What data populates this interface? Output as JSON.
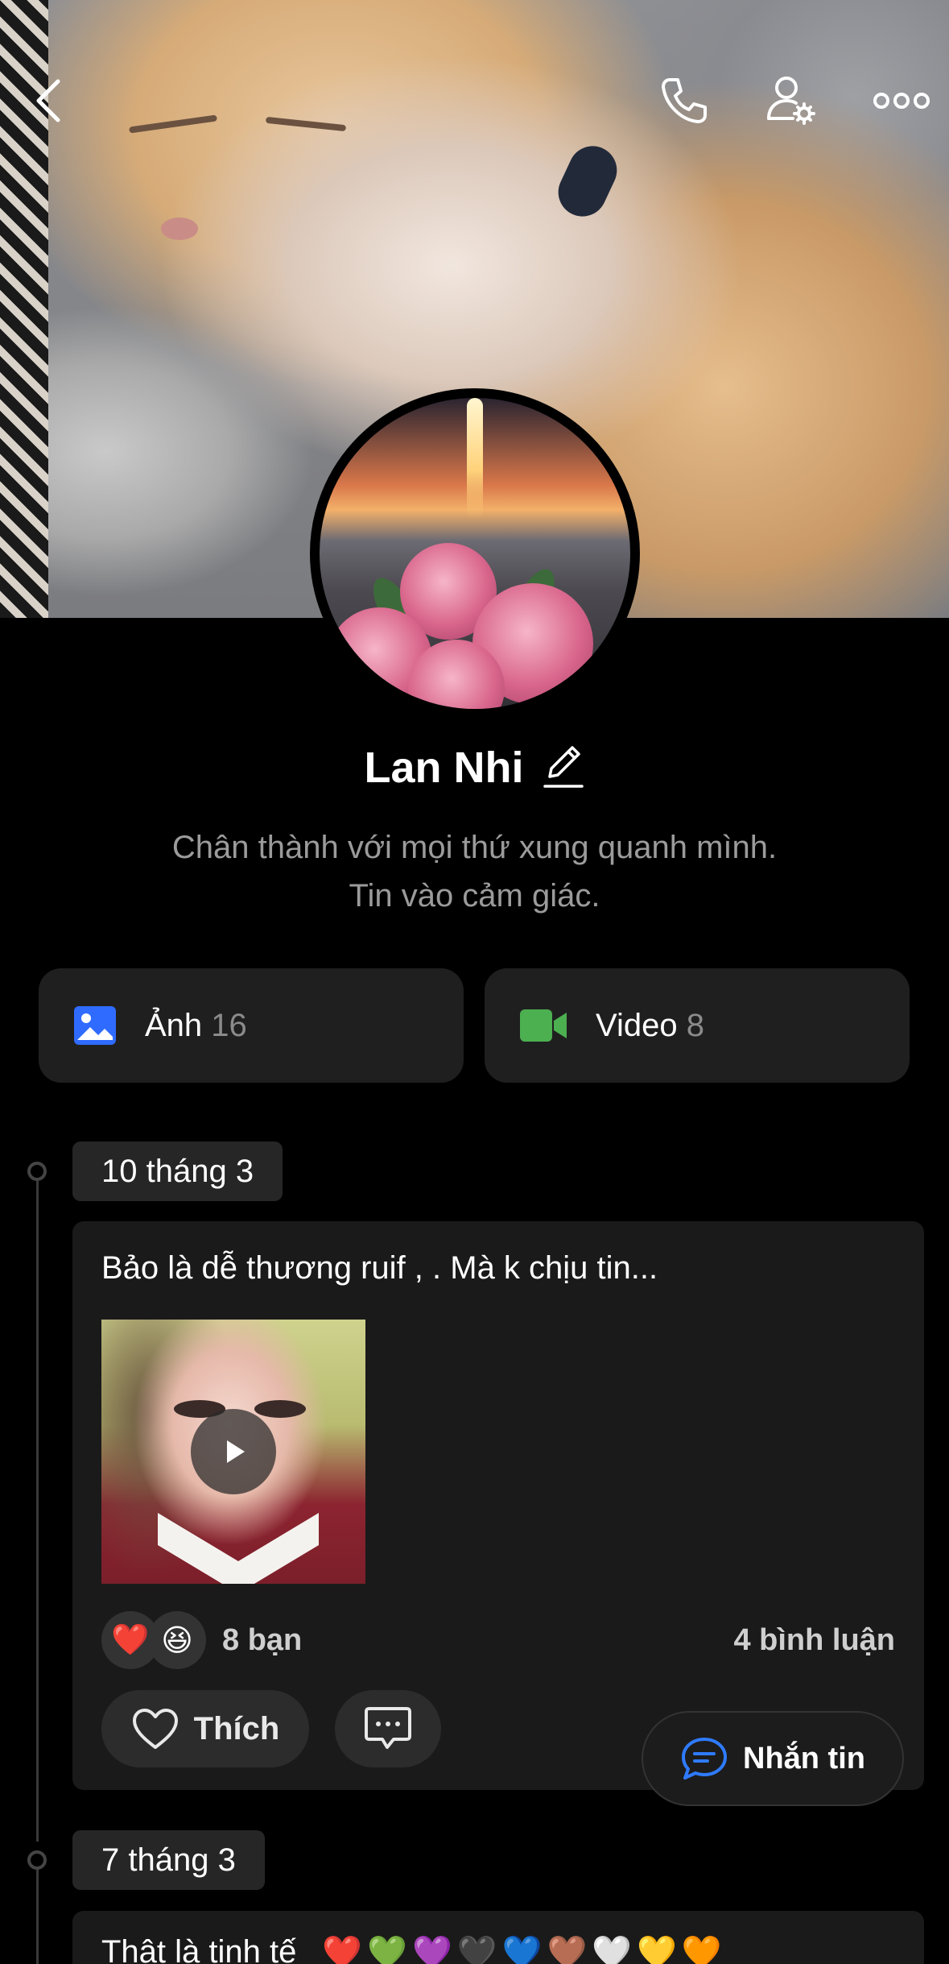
{
  "profile": {
    "name": "Lan Nhi",
    "bio_line1": "Chân thành với mọi thứ xung quanh mình.",
    "bio_line2": "Tin vào cảm giác."
  },
  "media": {
    "photos_label": "Ảnh",
    "photos_count": "16",
    "videos_label": "Video",
    "videos_count": "8"
  },
  "timeline": [
    {
      "date": "10 tháng 3",
      "text": "Bảo là dễ thương ruif , . Mà k chịu tin...",
      "reaction_emojis": [
        "❤️",
        "😆"
      ],
      "reaction_count": "8 bạn",
      "comment_count": "4 bình luận",
      "like_label": "Thích"
    },
    {
      "date": "7 tháng 3",
      "text": "Thật là tinh tế",
      "hearts": [
        "❤️",
        "💚",
        "💜",
        "🖤",
        "💙",
        "🤎",
        "🤍",
        "💛",
        "🧡"
      ]
    }
  ],
  "fab": {
    "label": "Nhắn tin"
  },
  "colors": {
    "background": "#000000",
    "card": "#1a1a1a",
    "photo_icon": "#2f6bff",
    "video_icon": "#4caf50",
    "message_icon": "#2f7bff"
  },
  "icons": [
    "back-icon",
    "phone-icon",
    "user-settings-icon",
    "more-icon",
    "edit-icon",
    "photo-icon",
    "video-icon",
    "play-icon",
    "heart-outline-icon",
    "comment-icon",
    "message-icon"
  ]
}
